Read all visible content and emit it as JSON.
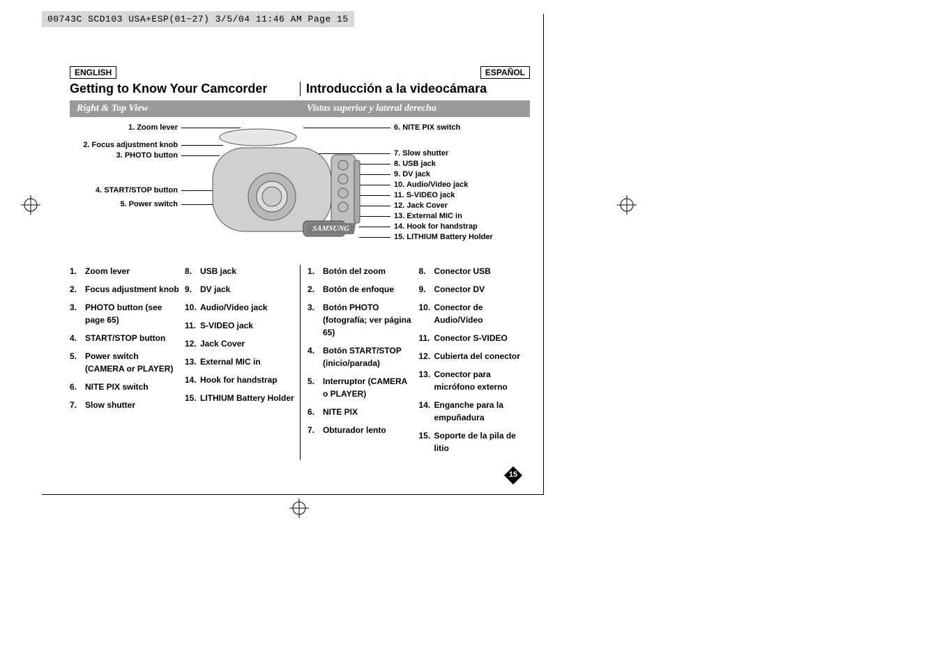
{
  "crop_info": "00743C SCD103 USA+ESP(01~27)  3/5/04 11:46 AM  Page 15",
  "lang": {
    "en": "ENGLISH",
    "es": "ESPAÑOL"
  },
  "title": {
    "en": "Getting to Know Your Camcorder",
    "es": "Introducción a la videocámara"
  },
  "subtitle": {
    "en": "Right & Top View",
    "es": "Vistas superior y lateral derecha"
  },
  "brand_badge": "SAMSUNG",
  "page_number": "15",
  "diagram_labels_left": [
    "1. Zoom lever",
    "2. Focus adjustment knob",
    "3. PHOTO button",
    "4. START/STOP button",
    "5. Power switch"
  ],
  "diagram_labels_right": [
    "6. NITE PIX switch",
    "7. Slow shutter",
    "8. USB jack",
    "9. DV jack",
    "10. Audio/Video jack",
    "11. S-VIDEO jack",
    "12. Jack Cover",
    "13. External MIC in",
    "14. Hook for handstrap",
    "15. LITHIUM Battery Holder"
  ],
  "list_en_a": [
    {
      "n": "1.",
      "t": "Zoom lever"
    },
    {
      "n": "2.",
      "t": "Focus adjustment knob"
    },
    {
      "n": "3.",
      "t": "PHOTO button (see page 65)"
    },
    {
      "n": "4.",
      "t": "START/STOP button"
    },
    {
      "n": "5.",
      "t": "Power switch (CAMERA or PLAYER)"
    },
    {
      "n": "6.",
      "t": "NITE PIX switch"
    },
    {
      "n": "7.",
      "t": "Slow shutter"
    }
  ],
  "list_en_b": [
    {
      "n": "8.",
      "t": "USB jack"
    },
    {
      "n": "9.",
      "t": "DV jack"
    },
    {
      "n": "10.",
      "t": "Audio/Video jack"
    },
    {
      "n": "11.",
      "t": "S-VIDEO jack"
    },
    {
      "n": "12.",
      "t": "Jack Cover"
    },
    {
      "n": "13.",
      "t": "External MIC in"
    },
    {
      "n": "14.",
      "t": "Hook for handstrap"
    },
    {
      "n": "15.",
      "t": "LITHIUM Battery Holder"
    }
  ],
  "list_es_a": [
    {
      "n": "1.",
      "t": "Botón del zoom"
    },
    {
      "n": "2.",
      "t": "Botón de enfoque"
    },
    {
      "n": "3.",
      "t": "Botón PHOTO (fotografía; ver página 65)"
    },
    {
      "n": "4.",
      "t": "Botón START/STOP (inicio/parada)"
    },
    {
      "n": "5.",
      "t": "Interruptor (CAMERA o PLAYER)"
    },
    {
      "n": "6.",
      "t": "NITE PIX"
    },
    {
      "n": "7.",
      "t": "Obturador lento"
    }
  ],
  "list_es_b": [
    {
      "n": "8.",
      "t": "Conector USB"
    },
    {
      "n": "9.",
      "t": "Conector DV"
    },
    {
      "n": "10.",
      "t": "Conector de Audio/Vídeo"
    },
    {
      "n": "11.",
      "t": "Conector S-VIDEO"
    },
    {
      "n": "12.",
      "t": "Cubierta del conector"
    },
    {
      "n": "13.",
      "t": "Conector para micrófono externo"
    },
    {
      "n": "14.",
      "t": "Enganche para la empuñadura"
    },
    {
      "n": "15.",
      "t": "Soporte de la pila de litio"
    }
  ]
}
